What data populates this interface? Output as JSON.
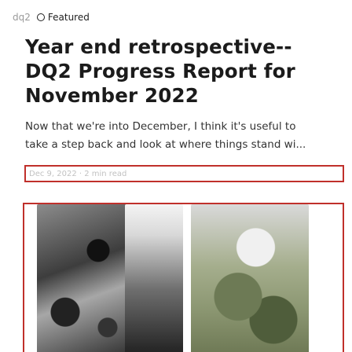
{
  "post": {
    "tag": "dq2",
    "featured_label": "Featured",
    "title": "Year end retrospective-- DQ2 Progress Report for November 2022",
    "excerpt_line1": "Now that we're into December, I think it's useful to",
    "excerpt_line2": "take a step back and look at where things stand wi...",
    "meta": "Dec 9, 2022 · 2 min read"
  },
  "icons": {
    "featured": "featured-circle-icon"
  }
}
